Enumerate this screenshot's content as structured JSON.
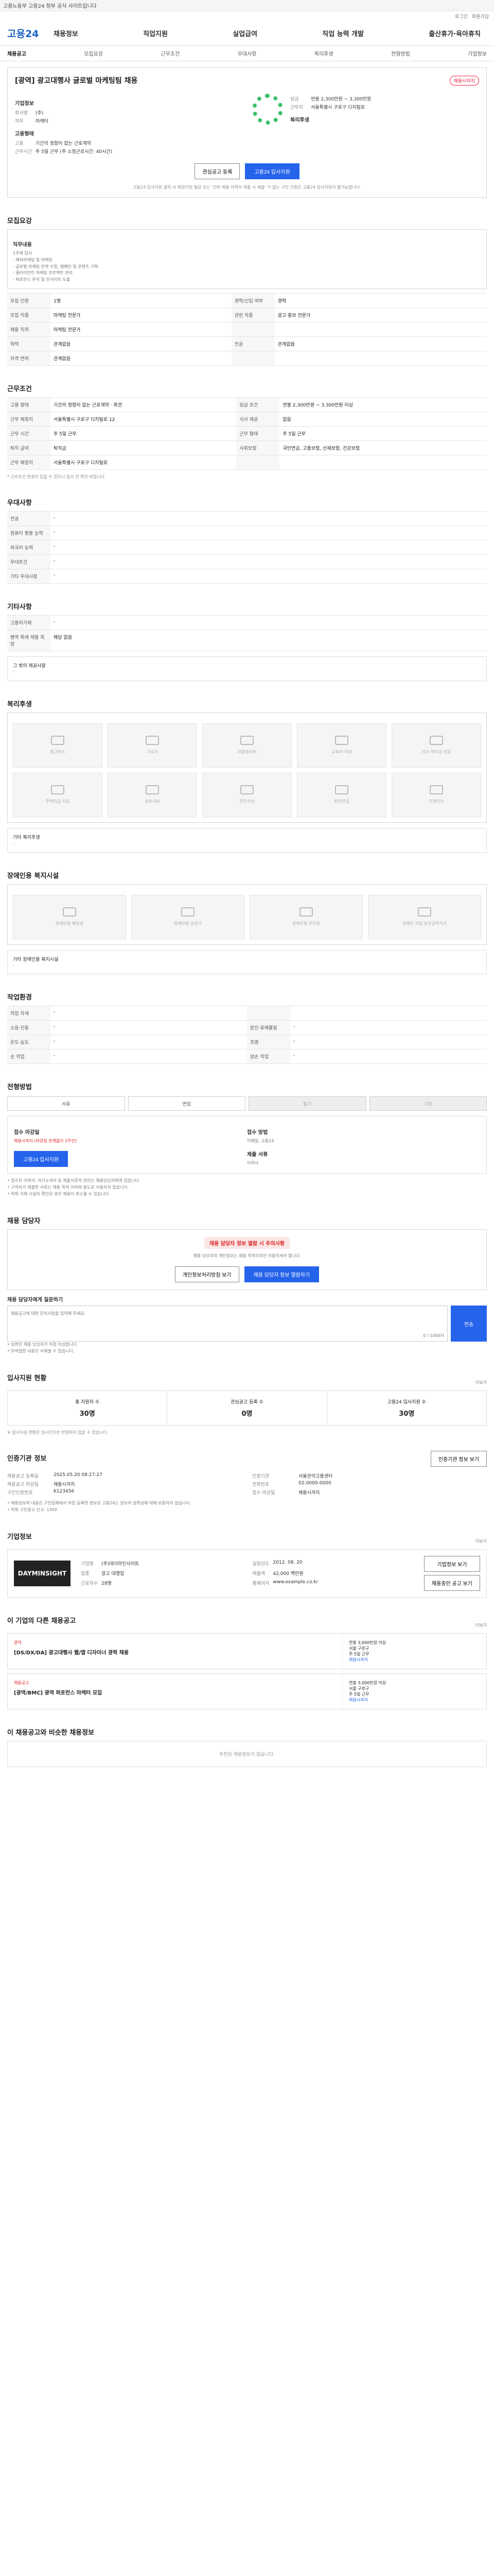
{
  "topbar": {
    "text": "고용노동부 고용24 정부 공식 사이트입니다"
  },
  "gnb": {
    "logo": "고용24",
    "menu": [
      "채용정보",
      "직업지원",
      "실업급여",
      "직업 능력 개발",
      "출산휴가·육아휴직"
    ],
    "util": [
      "로그인",
      "회원가입"
    ]
  },
  "tabs": [
    "채용공고",
    "모집요강",
    "근무조건",
    "우대사항",
    "복리후생",
    "전형방법",
    "기업정보"
  ],
  "job": {
    "title": "[광역] 광고대행사 글로벌 마케팅팀 채용",
    "badge": "채용시까지",
    "company_label": "기업정보",
    "company_name": "(주)",
    "pos_label": "직무",
    "pos_value": "마케터",
    "cond_label": "고용형태",
    "cond_type": "기간의 정함이 없는 근로계약",
    "cond_hours_k": "근무시간",
    "cond_hours": "주 5일 근무 (주 소정근로시간: 40시간)",
    "pay_label": "임금",
    "pay_value": "연봉 2,300만원 ~ 3,300만원",
    "addr_label": "근무지",
    "addr_value": "서울특별시 구로구 디지털로",
    "right_label": "복리후생",
    "btn_save": "관심공고 등록",
    "btn_apply": "고용24 입사지원",
    "note": "고용24 입사지원 클릭 시 회원가입 필요 또는 '간편 체용 이력서 제출 시 제출' 가 없는 구인 신청은 고용24 입사지원이 불가능합니다."
  },
  "recruit": {
    "title": "모집요강",
    "duty_label": "직무내용",
    "duty_lines": [
      "1주에 입사",
      "- 해외마케팅 및 마케팅",
      "- 글로벌 마케팅 전략 수립, 캠페인 및 콘텐츠 기획",
      "- 클라이언트 마케팅 프로젝트 관리",
      "- 퍼포먼스 분석 및 인사이트 도출"
    ],
    "rows": [
      [
        "모집 인원",
        "1명",
        "경력/신입 여부",
        "경력"
      ],
      [
        "모집 직종",
        "마케팅 전문가",
        "관련 직종",
        "광고·홍보 전문가"
      ],
      [
        "채용 직위",
        "마케팅 전문가",
        "",
        ""
      ],
      [
        "학력",
        "관계없음",
        "전공",
        "관계없음"
      ],
      [
        "자격 면허",
        "관계없음",
        "",
        ""
      ]
    ]
  },
  "work": {
    "title": "근무조건",
    "rows": [
      [
        "고용 형태",
        "기간의 정함이 없는 근로계약 · 파견",
        "임금 조건",
        "연봉 2,300만원 ~ 3,300만원 이상"
      ],
      [
        "근무 예정지",
        "서울특별시 구로구 디지털로 12",
        "식사 제공",
        "없음"
      ],
      [
        "근무 시간",
        "주 5일 근무",
        "근무 형태",
        "주 5일 근무"
      ],
      [
        "퇴직 급여",
        "퇴직금",
        "사회보험",
        "국민연금, 고용보험, 산재보험, 건강보험"
      ],
      [
        "근무 예정지",
        "서울특별시 구로구 디지털로",
        "",
        ""
      ]
    ],
    "note": "* 근로조건 변경이 있을 수 있으니 입사 전 확인 바랍니다."
  },
  "prefer": {
    "title": "우대사항",
    "rows": [
      [
        "전공",
        "-"
      ],
      [
        "컴퓨터 활용 능력",
        "-"
      ],
      [
        "외국어 능력",
        "-"
      ],
      [
        "우대조건",
        "-"
      ],
      [
        "기타 우대사항",
        "-"
      ]
    ]
  },
  "other": {
    "title": "기타사항",
    "rows": [
      [
        "고용허가제",
        "-"
      ],
      [
        "병역 특례 채용 희망",
        "해당 없음"
      ]
    ],
    "note_label": "그 밖의 제공사항",
    "note_value": "-"
  },
  "welfare": {
    "title": "복리후생",
    "items": [
      "통근버스",
      "기숙사",
      "차량유지비",
      "교육비 지원",
      "자녀 학자금 지원",
      "주택자금 지원",
      "경조사비",
      "연차수당",
      "퇴직연금",
      "인센티브"
    ],
    "extra_label": "기타 복리후생",
    "extra_value": "-"
  },
  "disabled": {
    "title": "장애인용 복지시설",
    "items": [
      "장애인용 화장실",
      "장애인용 승강기",
      "장애인용 주차장",
      "장애인 작업 보조공학기기"
    ],
    "extra_label": "기타 장애인용 복지시설",
    "extra_value": "-"
  },
  "env": {
    "title": "작업환경",
    "rows": [
      [
        "작업 자세",
        "-",
        "",
        ""
      ],
      [
        "소음·진동",
        "-",
        "분진·유해물질",
        "-"
      ],
      [
        "온도·습도",
        "-",
        "조명",
        "-"
      ],
      [
        "손 작업",
        "-",
        "양손 작업",
        "-"
      ]
    ]
  },
  "process": {
    "title": "전형방법",
    "options": [
      "서류",
      "면접",
      "필기",
      "기타"
    ],
    "contact_label": "접수 마감일",
    "contact_value": "채용시까지 (마감일 관계없이 2주간)",
    "method_label": "접수 방법",
    "method_value": "이메일, 고용24",
    "doc_label": "제출 서류",
    "doc_value": "이력서",
    "btn": "고용24 입사지원",
    "notes": [
      "• 접수된 이력서, 자기소개서 등 제출서류의 관리는 채용담당자에게 있습니다.",
      "• 구직자가 제출한 서류는 채용 목적 이외의 용도로 사용되지 않습니다.",
      "• 허위 기재 사실이 확인된 경우 채용이 취소될 수 있습니다."
    ]
  },
  "manager": {
    "title": "채용 담당자",
    "alert": "채용 담당자 정보 열람 시 주의사항",
    "desc": "채용 담당자의 개인정보는 채용 목적으로만 이용하셔야 합니다.",
    "btn1": "개인정보처리방침 보기",
    "btn2": "채용 담당자 정보 열람하기"
  },
  "question": {
    "label": "채용 담당자에게 질문하기",
    "placeholder": "채용공고에 대한 문의사항을 입력해 주세요.",
    "count": "0 / 1000자",
    "btn": "전송",
    "notes": [
      "• 답변은 채용 담당자가 직접 작성합니다.",
      "• 부적절한 내용은 삭제될 수 있습니다."
    ]
  },
  "stats": {
    "title": "입사지원 현황",
    "more": "더보기",
    "items": [
      [
        "총 지원자 수",
        "30명"
      ],
      [
        "관심공고 등록 수",
        "0명"
      ],
      [
        "고용24 입사지원 수",
        "30명"
      ]
    ],
    "note": "※ 입사지원 현황은 실시간으로 반영되지 않을 수 있습니다."
  },
  "info": {
    "title": "인증기관 정보",
    "btn": "인증기관 정보 보기",
    "left": [
      [
        "채용공고 등록일",
        "2025.05.20 08:27:27"
      ],
      [
        "채용공고 마감일",
        "채용시까지"
      ],
      [
        "구인인증번호",
        "K123456"
      ]
    ],
    "right": [
      [
        "인증기관",
        "서울관악고용센터"
      ],
      [
        "전화번호",
        "02-0000-0000"
      ],
      [
        "접수 마감일",
        "채용시까지"
      ]
    ],
    "notes": [
      "• 채용정보의 내용은 구인업체에서 직접 등록한 정보로 고용24는 정보의 정확성에 대해 보증하지 않습니다.",
      "• 허위 구인광고 신고: 1350"
    ]
  },
  "company": {
    "title": "기업정보",
    "more": "더보기",
    "logo": "DAYMINSIGHT",
    "rows": [
      [
        "기업명",
        "(주)데이마인사이트"
      ],
      [
        "업종",
        "광고 대행업"
      ],
      [
        "근로자수",
        "28명"
      ],
      [
        "설립년도",
        "2012. 08. 20"
      ],
      [
        "매출액",
        "42,000 백만원"
      ],
      [
        "홈페이지",
        "www.example.co.kr"
      ]
    ],
    "btn1": "기업정보 보기",
    "btn2": "채용중인 공고 보기"
  },
  "related": {
    "title": "이 기업의 다른 채용공고",
    "more": "더보기",
    "items": [
      {
        "badge": "광역",
        "title": "[DS/DX/DA] 광고대행사 웹/앱 디자이너 경력 채용",
        "pay": "연봉 3,000만원 이상",
        "loc": "서울 구로구",
        "tag": "채용시까지",
        "cond": "주 5일 근무"
      },
      {
        "badge": "채용공고",
        "title": "[광역/BMC] 광역 퍼포먼스 마케터 모집",
        "pay": "연봉 3,000만원 이상",
        "loc": "서울 구로구",
        "tag": "채용시까지",
        "cond": "주 5일 근무"
      }
    ]
  },
  "recommend": {
    "title": "이 채용공고와 비슷한 채용정보",
    "empty": "추천된 채용정보가 없습니다."
  }
}
